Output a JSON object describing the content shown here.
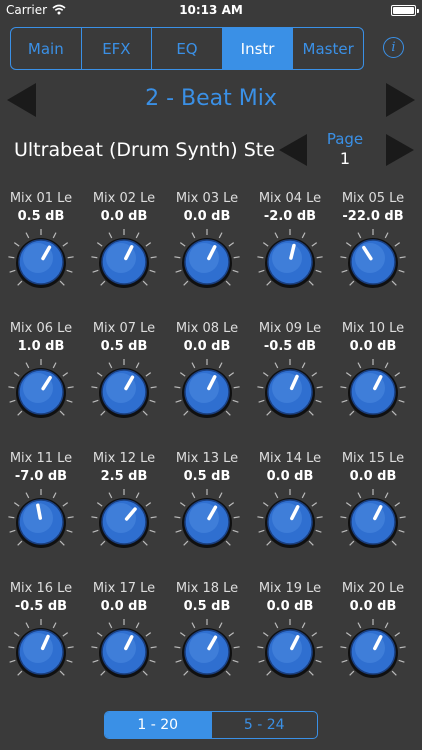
{
  "status_bar": {
    "carrier": "Carrier",
    "time": "10:13 AM"
  },
  "tabs": [
    {
      "label": "Main",
      "active": false
    },
    {
      "label": "EFX",
      "active": false
    },
    {
      "label": "EQ",
      "active": false
    },
    {
      "label": "Instr",
      "active": true
    },
    {
      "label": "Master",
      "active": false
    }
  ],
  "info_icon": "i",
  "preset": {
    "title": "2 - Beat Mix"
  },
  "instrument": {
    "name": "Ultrabeat  (Drum Synth) Ste",
    "page_label": "Page",
    "page_number": "1"
  },
  "knobs": [
    {
      "label": "Mix 01 Le",
      "value": "0.5 dB",
      "level": 0.61
    },
    {
      "label": "Mix 02 Le",
      "value": "0.0 dB",
      "level": 0.6
    },
    {
      "label": "Mix 03 Le",
      "value": "0.0 dB",
      "level": 0.6
    },
    {
      "label": "Mix 04 Le",
      "value": "-2.0 dB",
      "level": 0.55
    },
    {
      "label": "Mix 05 Le",
      "value": "-22.0 dB",
      "level": 0.38
    },
    {
      "label": "Mix 06 Le",
      "value": "1.0 dB",
      "level": 0.62
    },
    {
      "label": "Mix 07 Le",
      "value": "0.5 dB",
      "level": 0.61
    },
    {
      "label": "Mix 08 Le",
      "value": "0.0 dB",
      "level": 0.6
    },
    {
      "label": "Mix 09 Le",
      "value": "-0.5 dB",
      "level": 0.59
    },
    {
      "label": "Mix 10 Le",
      "value": "0.0 dB",
      "level": 0.6
    },
    {
      "label": "Mix 11 Le",
      "value": "-7.0 dB",
      "level": 0.46
    },
    {
      "label": "Mix 12 Le",
      "value": "2.5 dB",
      "level": 0.65
    },
    {
      "label": "Mix 13 Le",
      "value": "0.5 dB",
      "level": 0.61
    },
    {
      "label": "Mix 14 Le",
      "value": "0.0 dB",
      "level": 0.6
    },
    {
      "label": "Mix 15 Le",
      "value": "0.0 dB",
      "level": 0.6
    },
    {
      "label": "Mix 16 Le",
      "value": "-0.5 dB",
      "level": 0.59
    },
    {
      "label": "Mix 17 Le",
      "value": "0.0 dB",
      "level": 0.6
    },
    {
      "label": "Mix 18 Le",
      "value": "0.5 dB",
      "level": 0.61
    },
    {
      "label": "Mix 19 Le",
      "value": "0.0 dB",
      "level": 0.6
    },
    {
      "label": "Mix 20 Le",
      "value": "0.0 dB",
      "level": 0.6
    }
  ],
  "bank_control": [
    {
      "label": "1 - 20",
      "active": true
    },
    {
      "label": "5 - 24",
      "active": false
    }
  ],
  "colors": {
    "accent": "#3a90e6",
    "background": "#3a3a3a",
    "knob": "#2f6fd0"
  }
}
